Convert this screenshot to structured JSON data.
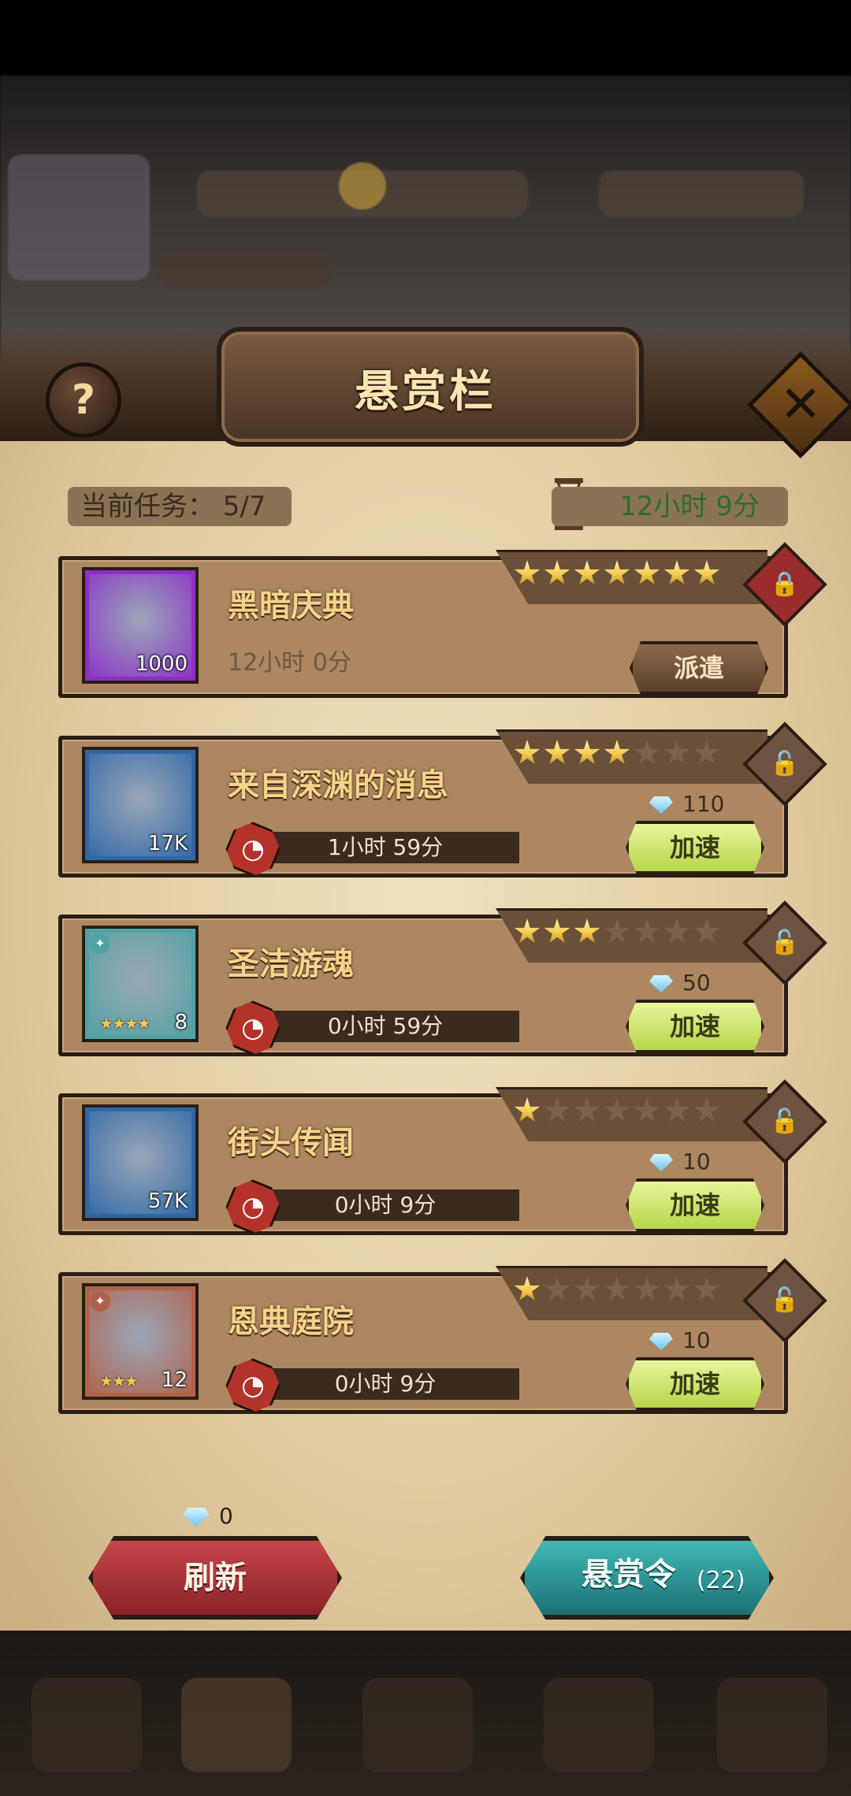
{
  "header": {
    "title": "悬赏栏",
    "help_icon": "?",
    "close_icon": "✕"
  },
  "status": {
    "current_tasks": "当前任务：  5/7",
    "timer": "12小时 9分"
  },
  "quests": [
    {
      "name": "黑暗庆典",
      "stars": 7,
      "max_stars": 7,
      "item_count": "1000",
      "item_color": "#8b2fc7",
      "time": "12小时 0分",
      "action": "派遣",
      "state": "idle",
      "lock": "locked"
    },
    {
      "name": "来自深渊的消息",
      "stars": 4,
      "max_stars": 7,
      "item_count": "17K",
      "item_color": "#2e67a6",
      "time": "1小时 59分",
      "cost": "110",
      "action": "加速",
      "state": "running",
      "lock": "unlocked"
    },
    {
      "name": "圣洁游魂",
      "stars": 3,
      "max_stars": 7,
      "item_count": "8",
      "item_stars": "★★★★",
      "item_color": "#4fa3a3",
      "time": "0小时 59分",
      "cost": "50",
      "action": "加速",
      "state": "running",
      "lock": "unlocked"
    },
    {
      "name": "街头传闻",
      "stars": 1,
      "max_stars": 7,
      "item_count": "57K",
      "item_color": "#2e67a6",
      "time": "0小时 9分",
      "cost": "10",
      "action": "加速",
      "state": "running",
      "lock": "unlocked"
    },
    {
      "name": "恩典庭院",
      "stars": 1,
      "max_stars": 7,
      "item_count": "12",
      "item_stars": "★★★",
      "item_color": "#b0614a",
      "time": "0小时 9分",
      "cost": "10",
      "action": "加速",
      "state": "running",
      "lock": "unlocked"
    }
  ],
  "footer": {
    "refresh_cost": "0",
    "refresh_label": "刷新",
    "bounty_label": "悬赏令",
    "bounty_count": "(22)"
  }
}
